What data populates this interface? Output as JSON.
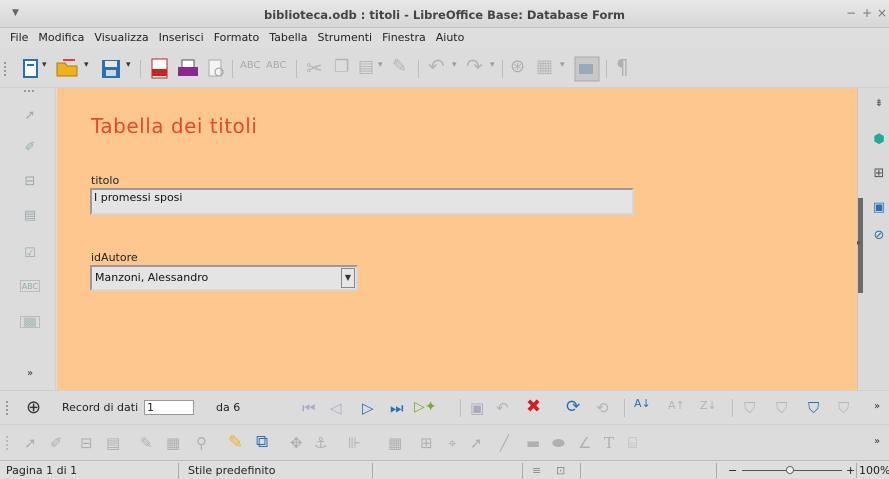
{
  "window": {
    "title": "biblioteca.odb : titoli - LibreOffice Base: Database Form",
    "controls": [
      "−",
      "+",
      "×"
    ]
  },
  "menu": [
    "File",
    "Modifica",
    "Visualizza",
    "Inserisci",
    "Formato",
    "Tabella",
    "Strumenti",
    "Finestra",
    "Aiuto"
  ],
  "form": {
    "title": "Tabella dei titoli",
    "title_color": "#e8492e",
    "background": "#fec78f",
    "titolo_label": "titolo",
    "titolo_value": "I promessi sposi",
    "idautore_label": "idAutore",
    "idautore_value": "Manzoni, Alessandro"
  },
  "navigation": {
    "record_label": "Record di dati",
    "record_value": "1",
    "of_label": "da 6"
  },
  "toolbar3_text_icon": "T",
  "status": {
    "page": "Pagina 1 di 1",
    "style": "Stile predefinito",
    "zoom_minus": "−",
    "zoom_plus": "+",
    "zoom": "100%"
  }
}
